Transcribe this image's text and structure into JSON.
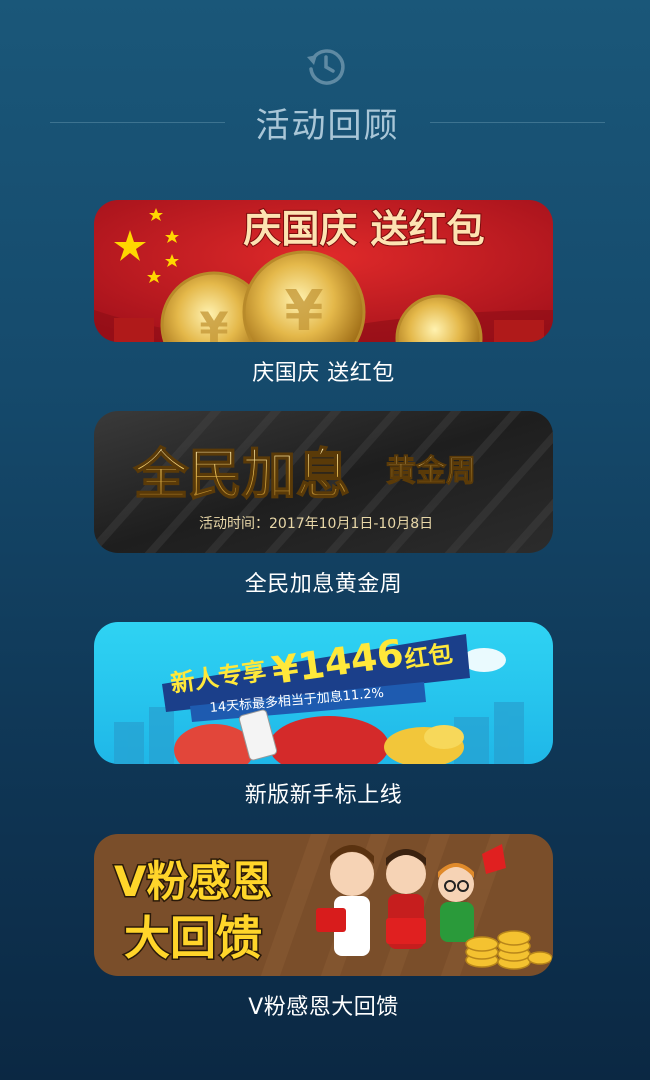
{
  "header": {
    "title": "活动回顾",
    "icon": "history-icon"
  },
  "colors": {
    "accent": "#a9c6d7",
    "background_top": "#1a5779",
    "background_bottom": "#0b2843"
  },
  "activities": [
    {
      "caption": "庆国庆 送红包",
      "banner": {
        "headline": "庆国庆 送红包"
      }
    },
    {
      "caption": "全民加息黄金周",
      "banner": {
        "headline": "全民加息",
        "tag": "黄金周",
        "subtitle": "活动时间：2017年10月1日-10月8日"
      }
    },
    {
      "caption": "新版新手标上线",
      "banner": {
        "headline_left": "新人专享",
        "headline_amount": "¥1446",
        "headline_right": "红包",
        "subtitle": "14天标最多相当于加息11.2%"
      }
    },
    {
      "caption": "V粉感恩大回馈",
      "banner": {
        "line1": "V粉感恩",
        "line2": "大回馈"
      }
    }
  ]
}
